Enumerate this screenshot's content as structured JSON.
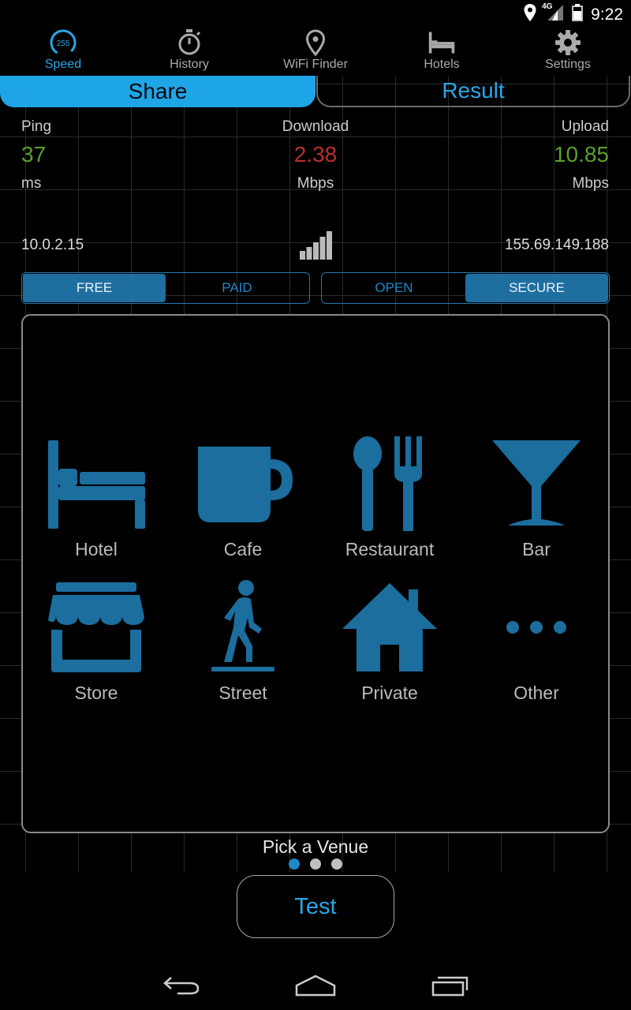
{
  "status_bar": {
    "time": "9:22",
    "network": "4G"
  },
  "nav": {
    "items": [
      {
        "label": "Speed",
        "icon": "speedometer-icon",
        "active": true
      },
      {
        "label": "History",
        "icon": "stopwatch-icon"
      },
      {
        "label": "WiFi Finder",
        "icon": "map-pin-icon"
      },
      {
        "label": "Hotels",
        "icon": "bed-icon"
      },
      {
        "label": "Settings",
        "icon": "gear-icon"
      }
    ],
    "speed_gauge_value": "255"
  },
  "tabs": {
    "share": "Share",
    "result": "Result"
  },
  "metrics": {
    "ping": {
      "label": "Ping",
      "value": "37",
      "unit": "ms",
      "color": "#5aa02c"
    },
    "download": {
      "label": "Download",
      "value": "2.38",
      "unit": "Mbps",
      "color": "#b8302a"
    },
    "upload": {
      "label": "Upload",
      "value": "10.85",
      "unit": "Mbps",
      "color": "#5aa02c"
    }
  },
  "ip": {
    "local": "10.0.2.15",
    "remote": "155.69.149.188"
  },
  "toggles": {
    "cost": {
      "free": "FREE",
      "paid": "PAID",
      "selected": "FREE"
    },
    "security": {
      "open": "OPEN",
      "secure": "SECURE",
      "selected": "SECURE"
    }
  },
  "venues": [
    {
      "label": "Hotel",
      "icon": "bed-icon"
    },
    {
      "label": "Cafe",
      "icon": "mug-icon"
    },
    {
      "label": "Restaurant",
      "icon": "utensils-icon"
    },
    {
      "label": "Bar",
      "icon": "cocktail-icon"
    },
    {
      "label": "Store",
      "icon": "storefront-icon"
    },
    {
      "label": "Street",
      "icon": "pedestrian-icon"
    },
    {
      "label": "Private",
      "icon": "house-icon"
    },
    {
      "label": "Other",
      "icon": "more-dots-icon"
    }
  ],
  "pick_label": "Pick a Venue",
  "pager": {
    "count": 3,
    "active": 0
  },
  "test_button": "Test",
  "colors": {
    "accent": "#1ea5e8",
    "icon_blue": "#1b6e9e",
    "grid": "#2a2a2a"
  }
}
